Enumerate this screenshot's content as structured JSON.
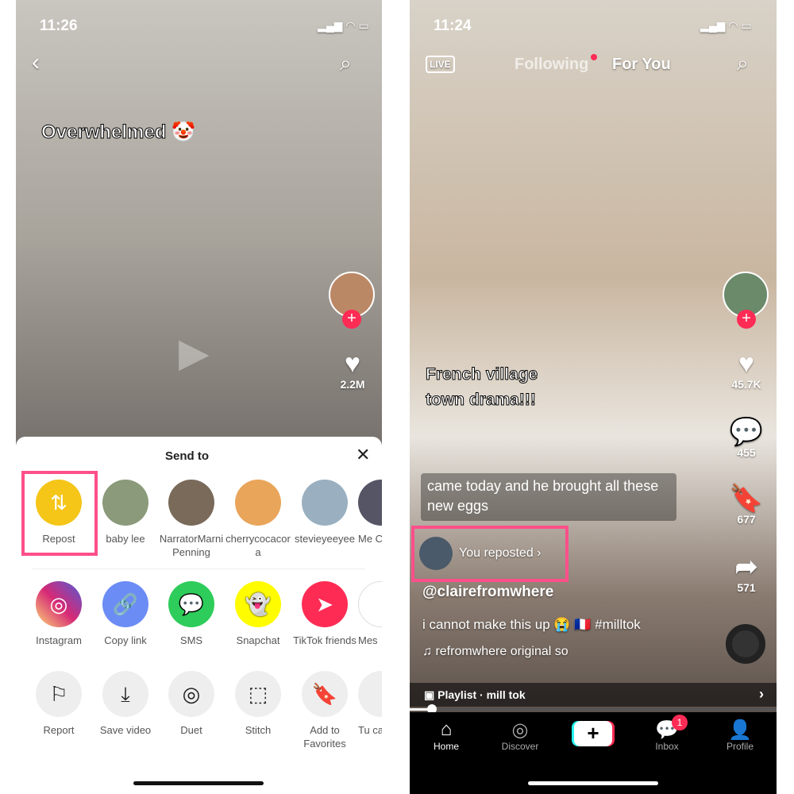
{
  "left": {
    "time": "11:26",
    "caption": "Overwhelmed 🤡",
    "like_count": "2.2M",
    "sheet": {
      "title": "Send to",
      "contacts": [
        {
          "label": "Repost",
          "icon": "repost-icon",
          "color": "#f5c518"
        },
        {
          "label": "baby lee"
        },
        {
          "label": "NarratorMarniPenning"
        },
        {
          "label": "cherrycocacora"
        },
        {
          "label": "stevieyeeyee"
        },
        {
          "label": "Me Cra"
        }
      ],
      "apps": [
        {
          "label": "Instagram",
          "icon": "instagram-icon",
          "color": "#d62976"
        },
        {
          "label": "Copy link",
          "icon": "link-icon",
          "color": "#6b8cf5"
        },
        {
          "label": "SMS",
          "icon": "sms-icon",
          "color": "#2ecc5a"
        },
        {
          "label": "Snapchat",
          "icon": "snapchat-icon",
          "color": "#fffc00"
        },
        {
          "label": "TikTok friends",
          "icon": "send-icon",
          "color": "#fe2c55"
        },
        {
          "label": "Mes",
          "icon": "messenger-icon",
          "color": "#fff"
        }
      ],
      "actions": [
        {
          "label": "Report",
          "icon": "flag-icon"
        },
        {
          "label": "Save video",
          "icon": "download-icon"
        },
        {
          "label": "Duet",
          "icon": "duet-icon"
        },
        {
          "label": "Stitch",
          "icon": "stitch-icon"
        },
        {
          "label": "Add to Favorites",
          "icon": "bookmark-icon"
        },
        {
          "label": "Tu ca",
          "icon": "more-icon"
        }
      ]
    }
  },
  "right": {
    "time": "11:24",
    "tabs": [
      "Following",
      "For You"
    ],
    "live": "LIVE",
    "caption": "French village town drama!!!",
    "subtitle": "came today and he brought all these new eggs",
    "reposted": "You reposted",
    "username": "@clairefromwhere",
    "description": "i cannot make this up 😭 🇫🇷 #milltok",
    "music": "refromwhere    original so",
    "counts": {
      "likes": "45.7K",
      "comments": "455",
      "saves": "677",
      "shares": "571"
    },
    "playlist": "Playlist · mill tok",
    "nav": [
      "Home",
      "Discover",
      "",
      "Inbox",
      "Profile"
    ],
    "inbox_badge": "1",
    "highlight_color": "#fe4f8a"
  }
}
